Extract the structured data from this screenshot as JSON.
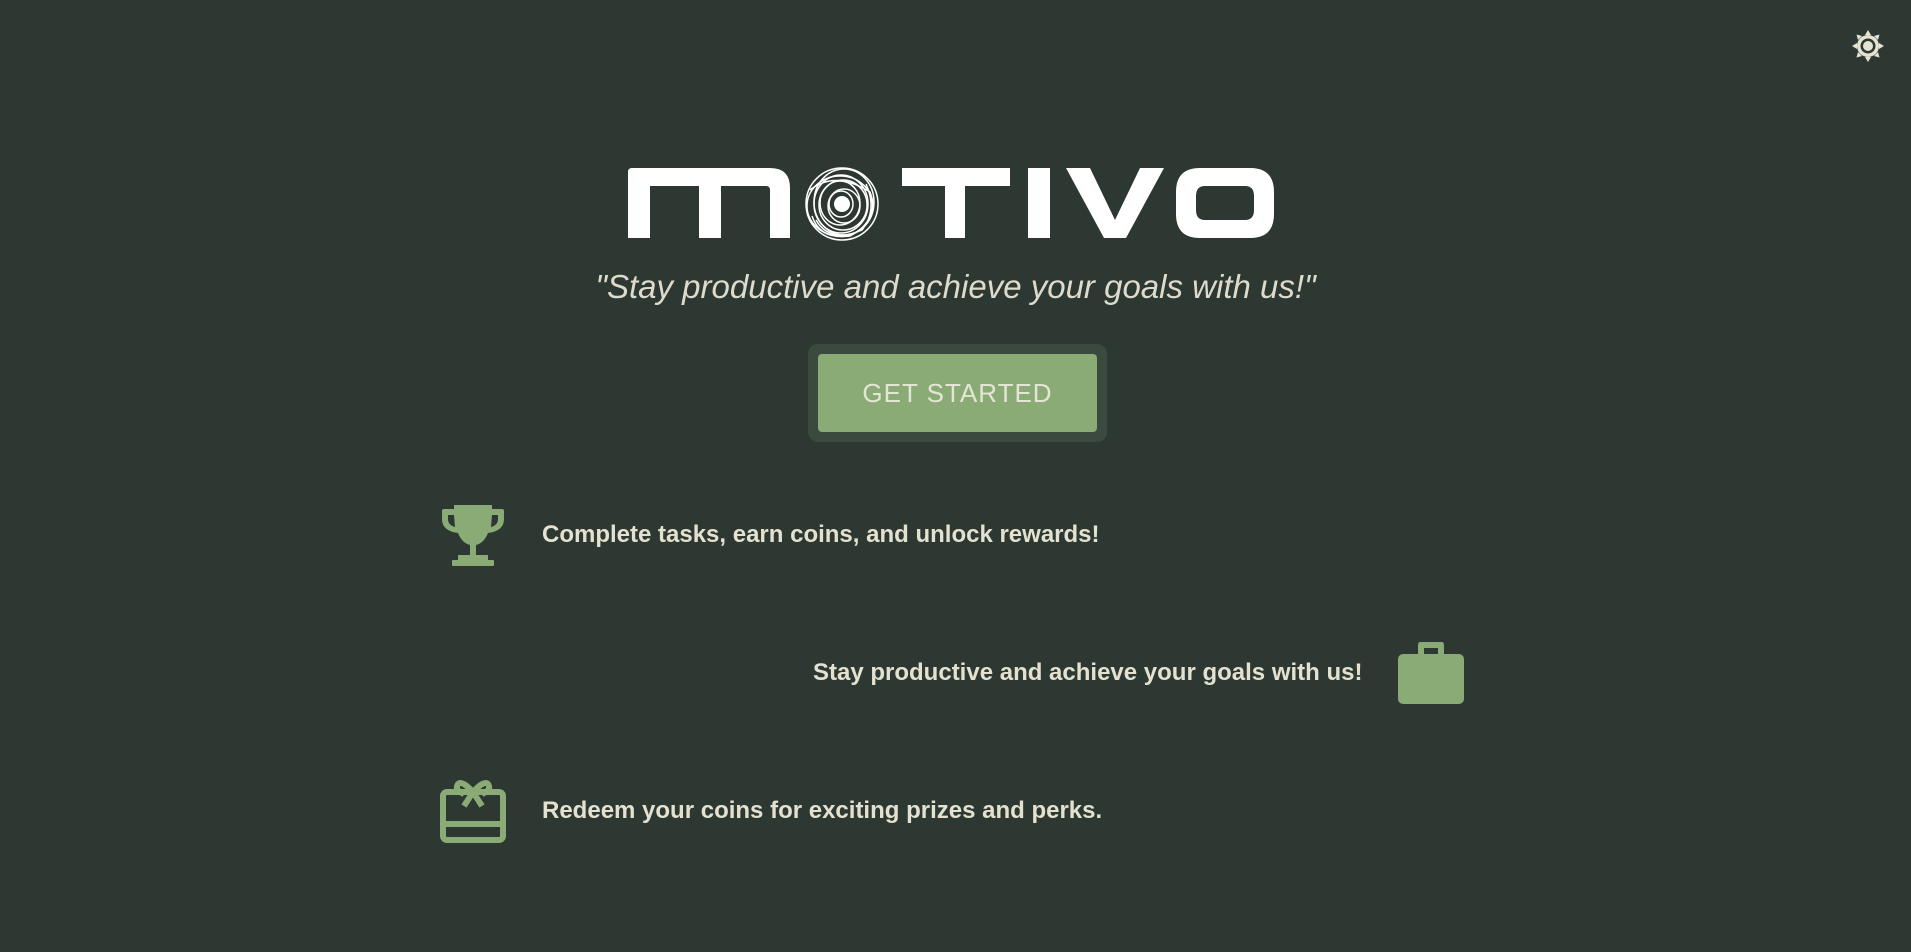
{
  "app": {
    "logo_text": "MOTIVO",
    "tagline": "\"Stay productive and achieve your goals with us!\""
  },
  "header": {
    "theme_toggle_icon": "sun-gear-icon"
  },
  "cta": {
    "label": "GET STARTED"
  },
  "features": [
    {
      "icon": "trophy-icon",
      "text": "Complete tasks, earn coins, and unlock rewards!"
    },
    {
      "icon": "briefcase-icon",
      "text": "Stay productive and achieve your goals with us!"
    },
    {
      "icon": "gift-card-icon",
      "text": "Redeem your coins for exciting prizes and perks."
    }
  ],
  "colors": {
    "background": "#2c3831",
    "accent": "#8aab75",
    "text": "#e4e1d0"
  }
}
